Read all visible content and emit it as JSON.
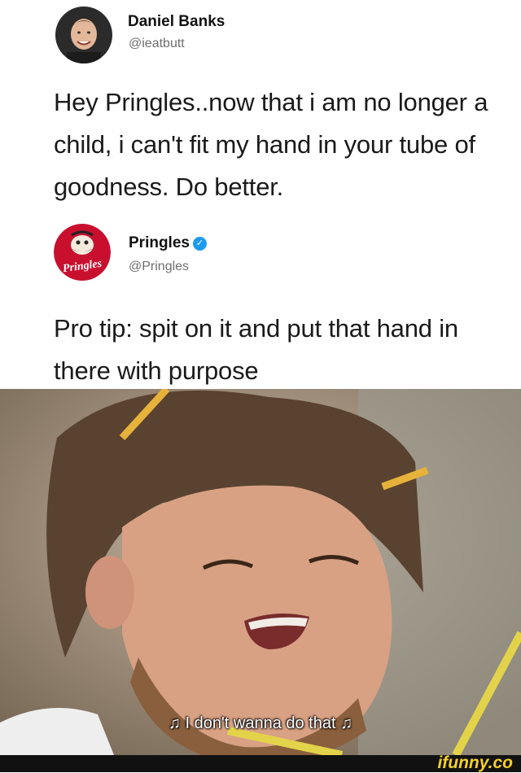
{
  "tweet1": {
    "name": "Daniel Banks",
    "handle": "@ieatbutt",
    "text": "Hey Pringles..now that i am no longer a child, i can't fit my hand in your tube of goodness. Do better."
  },
  "tweet2": {
    "name": "Pringles",
    "handle": "@Pringles",
    "logo_text": "Pringles",
    "text": "Pro tip: spit on it and put that hand in there with purpose"
  },
  "meme": {
    "subtitle": "♫ I don't wanna do that ♫"
  },
  "footer": {
    "brand": "ifunny.co"
  },
  "colors": {
    "verified": "#1d9bf0",
    "pringles_red": "#c8102e",
    "brand_yellow": "#f5cf2a"
  }
}
